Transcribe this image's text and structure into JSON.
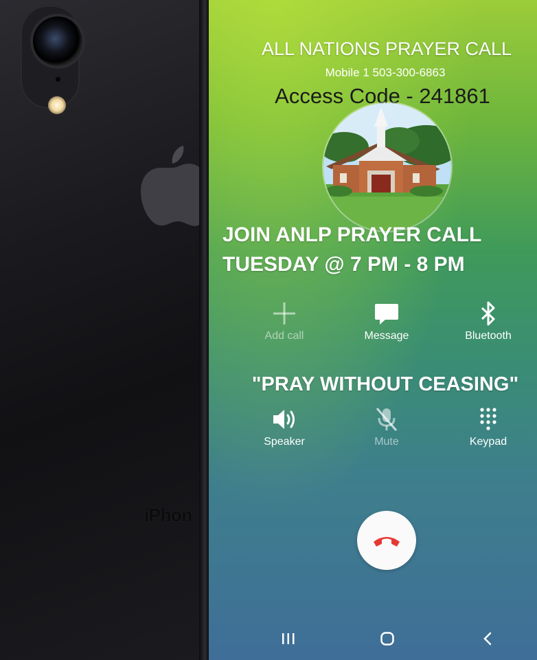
{
  "phone_back": {
    "model_text": "iPhon"
  },
  "screen": {
    "title": "ALL NATIONS PRAYER CALL",
    "mobile": "Mobile  1 503-300-6863",
    "access_code": "Access Code - 241861",
    "join_line1": "JOIN ANLP PRAYER CALL",
    "join_line2": "TUESDAY @ 7 PM - 8 PM",
    "quote": "\"PRAY WITHOUT CEASING\"",
    "actions_row1": [
      {
        "label": "Add call",
        "icon": "plus-icon",
        "enabled": false
      },
      {
        "label": "Message",
        "icon": "message-icon",
        "enabled": true
      },
      {
        "label": "Bluetooth",
        "icon": "bluetooth-icon",
        "enabled": true
      }
    ],
    "actions_row2": [
      {
        "label": "Speaker",
        "icon": "speaker-icon",
        "enabled": true
      },
      {
        "label": "Mute",
        "icon": "mic-off-icon",
        "enabled": false
      },
      {
        "label": "Keypad",
        "icon": "keypad-icon",
        "enabled": true
      }
    ],
    "end_call_icon": "end-call-icon",
    "colors": {
      "gradient_top": "#9ccc3a",
      "gradient_bottom": "#3f6e98",
      "end_call_red": "#e53935"
    }
  },
  "navbar": {
    "recents_icon": "recents-icon",
    "home_icon": "home-icon",
    "back_icon": "back-icon"
  }
}
